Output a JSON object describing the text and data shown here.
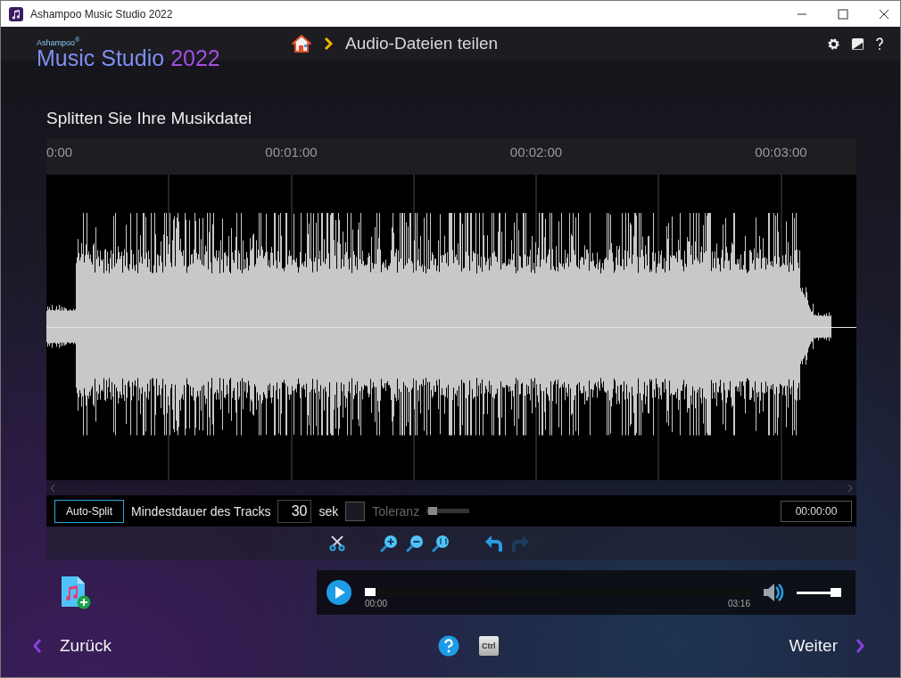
{
  "window": {
    "title": "Ashampoo Music Studio 2022"
  },
  "header": {
    "brand_small": "Ashampoo$^{®}$",
    "brand_name": "Music Studio",
    "brand_year": "2022",
    "page_title": "Audio-Dateien teilen"
  },
  "heading": "Splitten Sie Ihre Musikdatei",
  "timeline": {
    "ticks": [
      "0:00",
      "00:01:00",
      "00:02:00",
      "00:03:00"
    ]
  },
  "split_bar": {
    "auto_split": "Auto-Split",
    "min_duration_label": "Mindestdauer des Tracks",
    "min_duration_value": "30",
    "unit": "sek",
    "tolerance": {
      "checked": false,
      "label": "Toleranz",
      "disabled": true,
      "level": 0.05
    },
    "time_value": "00:00:00"
  },
  "player": {
    "position": {
      "level": 0.0
    },
    "start_time": "00:00",
    "end_time": "03:16",
    "volume": {
      "level": 0.9
    }
  },
  "footer": {
    "back": "Zurück",
    "next": "Weiter",
    "shortcut_key": "Ctrl"
  }
}
